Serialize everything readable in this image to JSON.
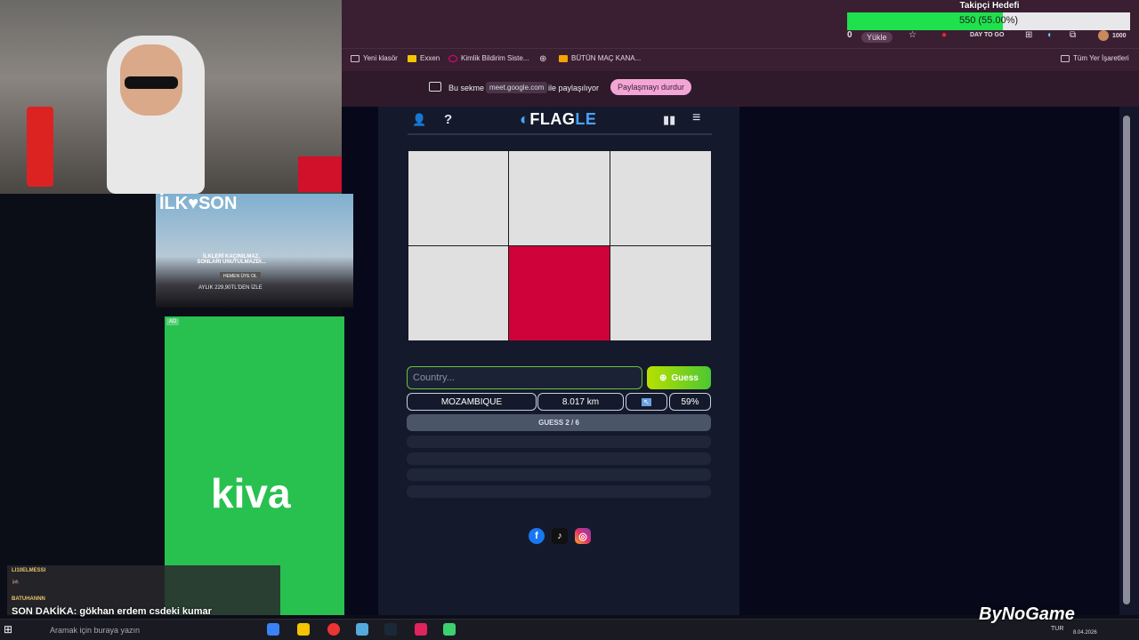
{
  "browser": {
    "toolbar": {
      "counter": "0",
      "upload_label": "Yükle",
      "bookmark_extra": "DAY TO GO",
      "score_badge": "1000"
    },
    "bookmarks": [
      {
        "label": "Yeni klasör"
      },
      {
        "label": "Exxen"
      },
      {
        "label": "Kimlik Bildirim Siste..."
      },
      {
        "label": "BÜTÜN MAÇ KANA..."
      }
    ],
    "all_bookmarks": "Tüm Yer İşaretleri",
    "share_bar": {
      "prefix": "Bu sekme",
      "site": "meet.google.com",
      "suffix": "ile paylaşılıyor",
      "stop_button": "Paylaşmayı durdur"
    }
  },
  "game": {
    "logo_main": "FLAG",
    "logo_accent": "LE",
    "input_placeholder": "Country...",
    "guess_button": "Guess",
    "flag_tiles": [
      false,
      false,
      false,
      false,
      true,
      false
    ],
    "revealed_color": "#cf0339",
    "guess_row": {
      "country": "MOZAMBIQUE",
      "distance": "8.017 km",
      "direction_icon": "arrow-up-left-icon",
      "proximity": "59%"
    },
    "guess_counter": "GUESS 2 / 6",
    "empty_rows": 4
  },
  "overlay": {
    "goal_title": "Takipçi Hedefi",
    "goal_text": "550 (55.00%)",
    "goal_progress": 0.55,
    "ad_top": {
      "headline": "İLK♥SON",
      "tagline": "İLKLERİ KAÇINILMAZ, SONLARI UNUTULMAZDI...",
      "cta": "HEMEN ÜYE OL",
      "price": "AYLIK 229,90TL'DEN İZLE"
    },
    "ad_label": "AD",
    "kiva": "kiva",
    "chat": [
      {
        "user": "LI10ELMESSI",
        "message": ""
      },
      {
        "user": "BATUHANNN",
        "message": "SON DAKİKA: gökhan erdem csdeki kumar sistemine yenik düştü hadi hayırlı olsun"
      }
    ],
    "watermark": "ByNoGame"
  },
  "taskbar": {
    "search_placeholder": "Aramak için buraya yazın",
    "lang": "TUR",
    "date": "8.04.2026"
  }
}
